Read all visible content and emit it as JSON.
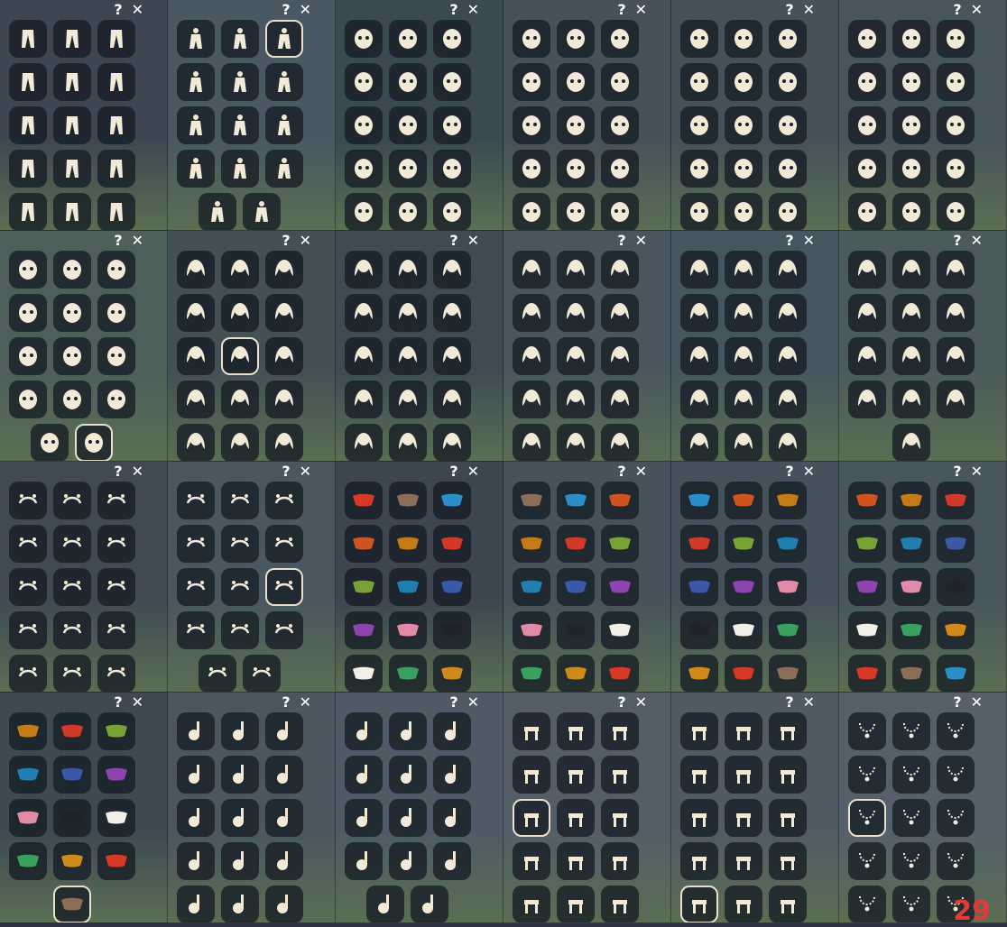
{
  "controls": {
    "help": "?",
    "close": "✕"
  },
  "page_badge": "29",
  "colors": {
    "ivory": "#f2ead6",
    "slot_bg": "#161c24",
    "badge": "#e53935"
  },
  "panels": [
    {
      "bg": "#3d4753",
      "cat": "pants",
      "n": 15,
      "offset": false,
      "sel": -1
    },
    {
      "bg": "#495863",
      "cat": "outfit",
      "n": 14,
      "offset": true,
      "sel": 2
    },
    {
      "bg": "#3b4a52",
      "cat": "mask",
      "n": 15,
      "offset": false,
      "sel": -1
    },
    {
      "bg": "#46515b",
      "cat": "mask",
      "n": 15,
      "offset": false,
      "sel": -1
    },
    {
      "bg": "#45525c",
      "cat": "mask",
      "n": 15,
      "offset": false,
      "sel": -1
    },
    {
      "bg": "#48555d",
      "cat": "mask",
      "n": 15,
      "offset": false,
      "sel": -1
    },
    {
      "bg": "#4e5f5c",
      "cat": "mask",
      "n": 14,
      "offset": true,
      "sel": 13
    },
    {
      "bg": "#435055",
      "cat": "hair",
      "n": 15,
      "offset": false,
      "sel": 7
    },
    {
      "bg": "#3e4b55",
      "cat": "hair",
      "n": 15,
      "offset": false,
      "sel": -1
    },
    {
      "bg": "#495660",
      "cat": "hair",
      "n": 15,
      "offset": false,
      "sel": -1
    },
    {
      "bg": "#465660",
      "cat": "hair",
      "n": 15,
      "offset": false,
      "sel": -1
    },
    {
      "bg": "#4b5b5b",
      "cat": "hair",
      "n": 13,
      "offset": true,
      "sel": -1
    },
    {
      "bg": "#3f4a55",
      "cat": "headwear",
      "n": 15,
      "offset": false,
      "sel": -1
    },
    {
      "bg": "#4a5760",
      "cat": "headwear",
      "n": 14,
      "offset": true,
      "sel": 8
    },
    {
      "bg": "#3c4752",
      "cat": "cape",
      "n": 15,
      "offset": false,
      "sel": -1
    },
    {
      "bg": "#46535d",
      "cat": "cape",
      "n": 15,
      "offset": false,
      "sel": -1
    },
    {
      "bg": "#45525d",
      "cat": "cape",
      "n": 15,
      "offset": false,
      "sel": -1
    },
    {
      "bg": "#48565d",
      "cat": "cape",
      "n": 15,
      "offset": false,
      "sel": -1
    },
    {
      "bg": "#3e4954",
      "cat": "cape",
      "n": 13,
      "offset": true,
      "sel": 12
    },
    {
      "bg": "#4b5661",
      "cat": "instrument",
      "n": 15,
      "offset": false,
      "sel": -1
    },
    {
      "bg": "#4f5a66",
      "cat": "instrument",
      "n": 14,
      "offset": true,
      "sel": -1
    },
    {
      "bg": "#535e69",
      "cat": "prop",
      "n": 15,
      "offset": false,
      "sel": 6
    },
    {
      "bg": "#505b66",
      "cat": "prop",
      "n": 15,
      "offset": false,
      "sel": 12
    },
    {
      "bg": "#55606b",
      "cat": "necklace",
      "n": 15,
      "offset": false,
      "sel": 6
    }
  ]
}
